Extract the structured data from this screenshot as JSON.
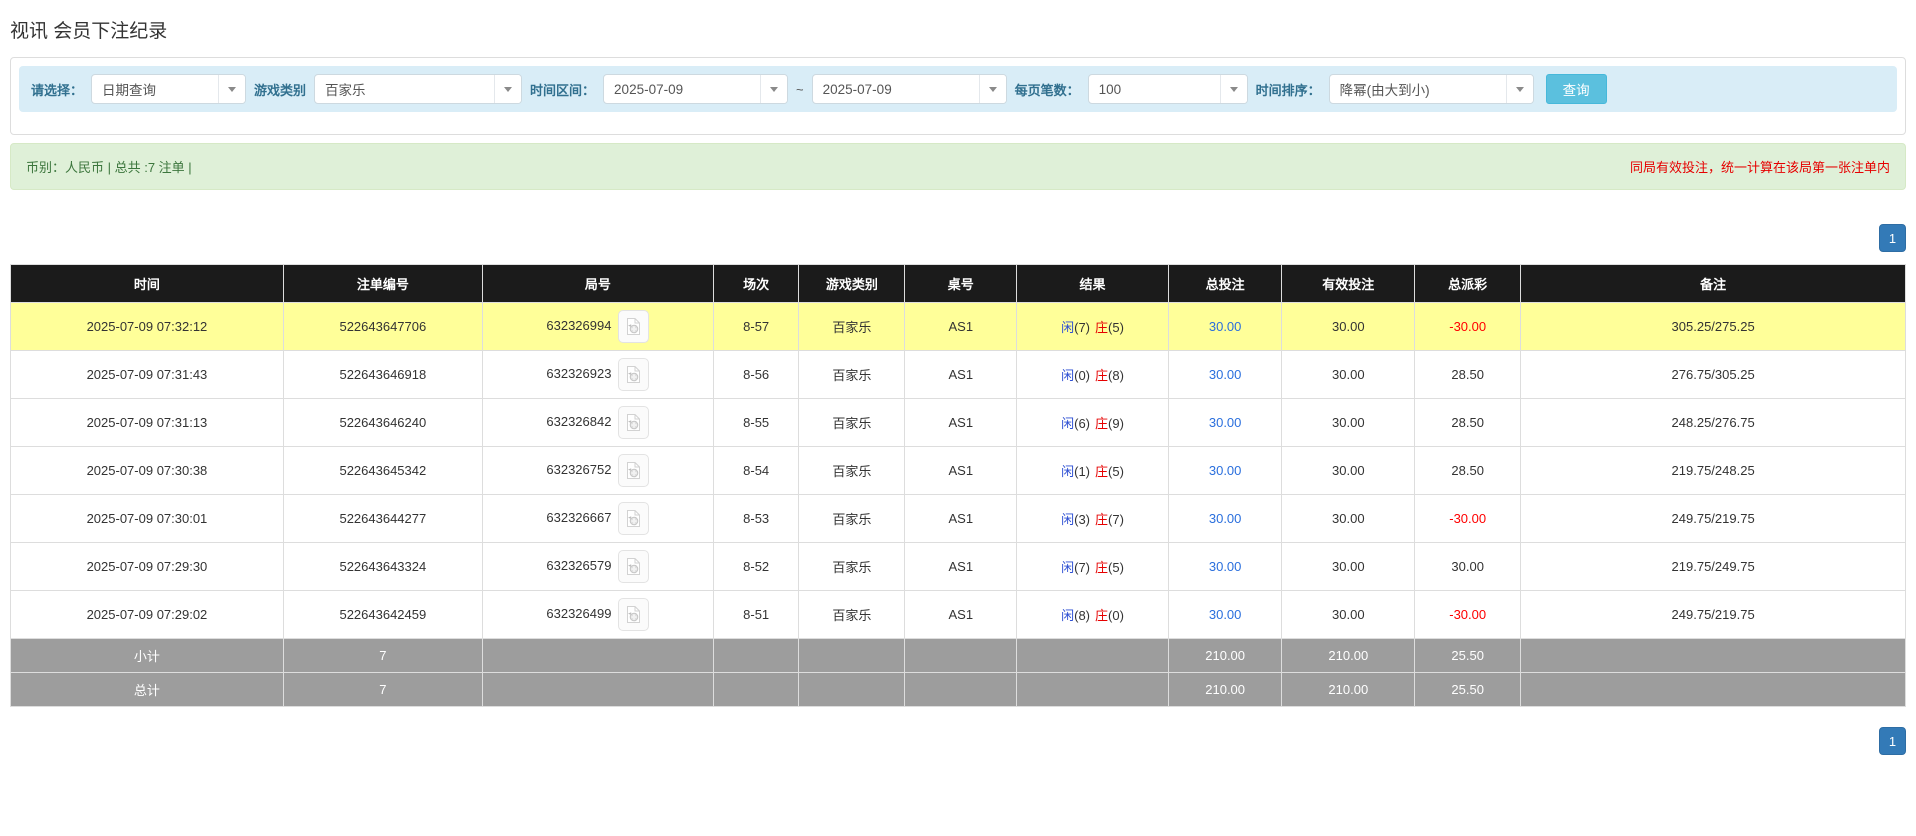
{
  "page": {
    "title": "视讯 会员下注纪录"
  },
  "filters": {
    "select_type": {
      "label": "请选择：",
      "value": "日期查询"
    },
    "game_type": {
      "label": "游戏类别",
      "value": "百家乐"
    },
    "time_range": {
      "label": "时间区间：",
      "from": "2025-07-09",
      "separator": "~",
      "to": "2025-07-09"
    },
    "page_size": {
      "label": "每页笔数：",
      "value": "100"
    },
    "time_sort": {
      "label": "时间排序：",
      "value": "降幂(由大到小)"
    },
    "search_button": "查询"
  },
  "summary": {
    "left": "币别：人民币 | 总共 :7 注单 |",
    "right": "同局有效投注，统一计算在该局第一张注单内"
  },
  "pagination": {
    "page": "1"
  },
  "table": {
    "headers": [
      "时间",
      "注单编号",
      "局号",
      "场次",
      "游戏类别",
      "桌号",
      "结果",
      "总投注",
      "有效投注",
      "总派彩",
      "备注"
    ],
    "rows": [
      {
        "time": "2025-07-09 07:32:12",
        "bet_id": "522643647706",
        "round_id": "632326994",
        "session": "8-57",
        "game": "百家乐",
        "table_no": "AS1",
        "player_label": "闲",
        "player_score": "(7)",
        "banker_label": "庄",
        "banker_score": "(5)",
        "total_bet": "30.00",
        "valid_bet": "30.00",
        "payout": "-30.00",
        "remark": "305.25/275.25",
        "highlighted": true
      },
      {
        "time": "2025-07-09 07:31:43",
        "bet_id": "522643646918",
        "round_id": "632326923",
        "session": "8-56",
        "game": "百家乐",
        "table_no": "AS1",
        "player_label": "闲",
        "player_score": "(0)",
        "banker_label": "庄",
        "banker_score": "(8)",
        "total_bet": "30.00",
        "valid_bet": "30.00",
        "payout": "28.50",
        "remark": "276.75/305.25",
        "highlighted": false
      },
      {
        "time": "2025-07-09 07:31:13",
        "bet_id": "522643646240",
        "round_id": "632326842",
        "session": "8-55",
        "game": "百家乐",
        "table_no": "AS1",
        "player_label": "闲",
        "player_score": "(6)",
        "banker_label": "庄",
        "banker_score": "(9)",
        "total_bet": "30.00",
        "valid_bet": "30.00",
        "payout": "28.50",
        "remark": "248.25/276.75",
        "highlighted": false
      },
      {
        "time": "2025-07-09 07:30:38",
        "bet_id": "522643645342",
        "round_id": "632326752",
        "session": "8-54",
        "game": "百家乐",
        "table_no": "AS1",
        "player_label": "闲",
        "player_score": "(1)",
        "banker_label": "庄",
        "banker_score": "(5)",
        "total_bet": "30.00",
        "valid_bet": "30.00",
        "payout": "28.50",
        "remark": "219.75/248.25",
        "highlighted": false
      },
      {
        "time": "2025-07-09 07:30:01",
        "bet_id": "522643644277",
        "round_id": "632326667",
        "session": "8-53",
        "game": "百家乐",
        "table_no": "AS1",
        "player_label": "闲",
        "player_score": "(3)",
        "banker_label": "庄",
        "banker_score": "(7)",
        "total_bet": "30.00",
        "valid_bet": "30.00",
        "payout": "-30.00",
        "remark": "249.75/219.75",
        "highlighted": false
      },
      {
        "time": "2025-07-09 07:29:30",
        "bet_id": "522643643324",
        "round_id": "632326579",
        "session": "8-52",
        "game": "百家乐",
        "table_no": "AS1",
        "player_label": "闲",
        "player_score": "(7)",
        "banker_label": "庄",
        "banker_score": "(5)",
        "total_bet": "30.00",
        "valid_bet": "30.00",
        "payout": "30.00",
        "remark": "219.75/249.75",
        "highlighted": false
      },
      {
        "time": "2025-07-09 07:29:02",
        "bet_id": "522643642459",
        "round_id": "632326499",
        "session": "8-51",
        "game": "百家乐",
        "table_no": "AS1",
        "player_label": "闲",
        "player_score": "(8)",
        "banker_label": "庄",
        "banker_score": "(0)",
        "total_bet": "30.00",
        "valid_bet": "30.00",
        "payout": "-30.00",
        "remark": "249.75/219.75",
        "highlighted": false
      }
    ],
    "subtotal": {
      "label": "小计",
      "count": "7",
      "total_bet": "210.00",
      "valid_bet": "210.00",
      "payout": "25.50"
    },
    "total": {
      "label": "总计",
      "count": "7",
      "total_bet": "210.00",
      "valid_bet": "210.00",
      "payout": "25.50"
    }
  },
  "colors": {
    "accent_blue": "#337ab7",
    "search_button": "#5bc0de",
    "filter_bar_bg": "#d9edf7",
    "filter_label": "#31708f",
    "alert_bg": "#dff0d8",
    "alert_text": "#3c763d",
    "alert_warning_text": "#e60000",
    "header_bg": "#1b1b1b",
    "footer_bg": "#9d9d9d",
    "highlight_row": "#ffff99",
    "link_blue": "#2a6fdd",
    "player_blue": "#2d4fd3",
    "banker_red": "#e60000",
    "negative_red": "#ff0000"
  }
}
